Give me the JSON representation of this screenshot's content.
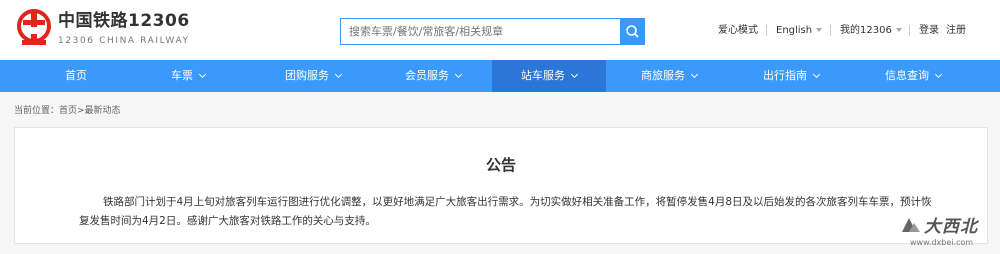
{
  "header": {
    "logo_title": "中国铁路12306",
    "logo_subtitle": "12306 CHINA RAILWAY",
    "search_placeholder": "搜索车票/餐饮/常旅客/相关规章",
    "links": {
      "care_mode": "爱心模式",
      "language": "English",
      "my12306": "我的12306",
      "login": "登录",
      "register": "注册"
    },
    "brand_color": "#3b99fc"
  },
  "mainnav": {
    "items": [
      {
        "label": "首页",
        "dropdown": false
      },
      {
        "label": "车票",
        "dropdown": true
      },
      {
        "label": "团购服务",
        "dropdown": true
      },
      {
        "label": "会员服务",
        "dropdown": true
      },
      {
        "label": "站车服务",
        "dropdown": true,
        "active": true
      },
      {
        "label": "商旅服务",
        "dropdown": true
      },
      {
        "label": "出行指南",
        "dropdown": true
      },
      {
        "label": "信息查询",
        "dropdown": true
      }
    ]
  },
  "breadcrumb": "当前位置：首页>最新动态",
  "notice": {
    "title": "公告",
    "body": "铁路部门计划于4月上旬对旅客列车运行图进行优化调整，以更好地满足广大旅客出行需求。为切实做好相关准备工作，将暂停发售4月8日及以后始发的各次旅客列车车票，预计恢复发售时间为4月2日。感谢广大旅客对铁路工作的关心与支持。"
  },
  "watermark": {
    "text": "大西北",
    "url": "www.dxbei.com"
  }
}
